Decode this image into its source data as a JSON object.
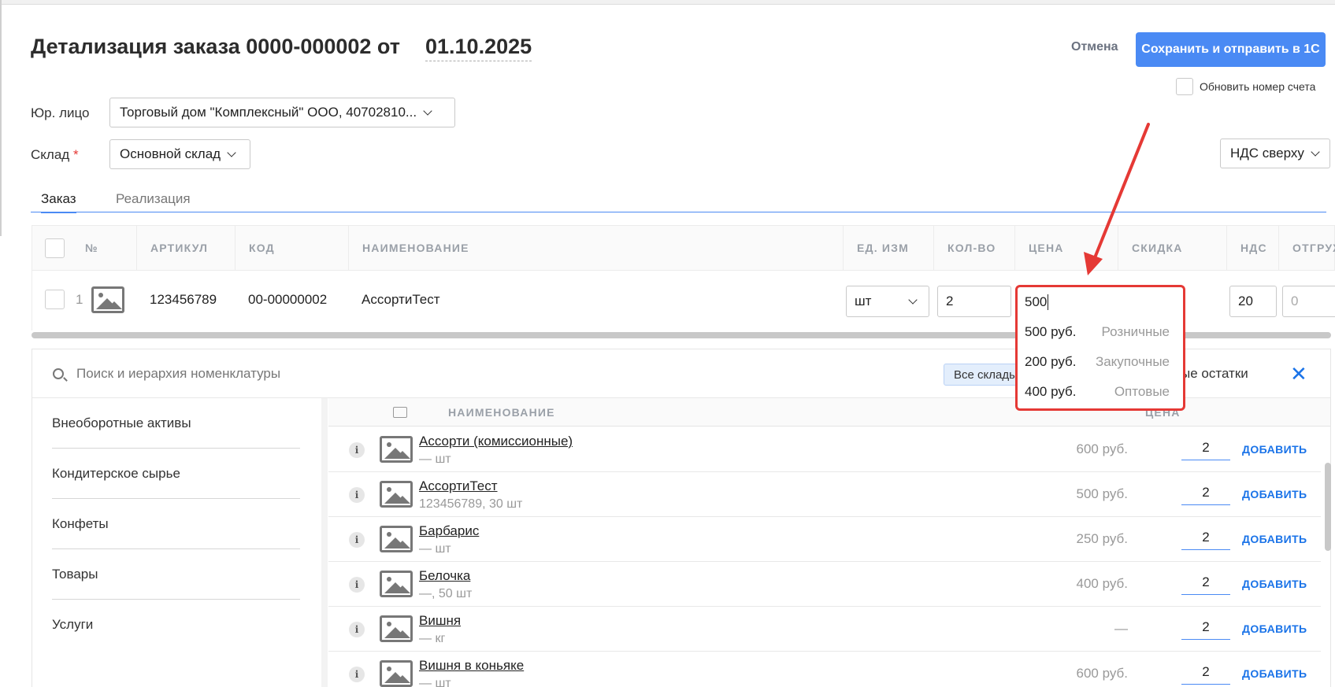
{
  "header": {
    "title": "Детализация заказа 0000-000002 от",
    "date": "01.10.2025",
    "cancel_label": "Отмена",
    "save_label": "Сохранить и отправить в 1С",
    "update_invoice_label": "Обновить номер счета"
  },
  "form": {
    "legal_label": "Юр. лицо",
    "legal_value": "Торговый дом \"Комплексный\" ООО, 40702810...",
    "warehouse_label": "Склад",
    "warehouse_required": "*",
    "warehouse_value": "Основной склад",
    "vat_mode": "НДС сверху"
  },
  "tabs": [
    "Заказ",
    "Реализация"
  ],
  "order_table": {
    "columns": [
      "№",
      "АРТИКУЛ",
      "КОД",
      "НАИМЕНОВАНИЕ",
      "ЕД. ИЗМ",
      "КОЛ-ВО",
      "ЦЕНА",
      "СКИДКА",
      "НДС",
      "ОТГРУЖЕНО"
    ],
    "rows": [
      {
        "num": "1",
        "article": "123456789",
        "code": "00-00000002",
        "name": "АссортиТест",
        "unit": "шт",
        "qty": "2",
        "price": "500",
        "vat": "20",
        "shipped": "0"
      }
    ]
  },
  "price_dropdown": [
    {
      "value": "500 руб.",
      "label": "Розничные"
    },
    {
      "value": "200 руб.",
      "label": "Закупочные"
    },
    {
      "value": "400 руб.",
      "label": "Оптовые"
    }
  ],
  "search": {
    "placeholder": "Поиск и иерархия номенклатуры",
    "all_warehouses": "Все склады",
    "stock_label": "ые остатки"
  },
  "categories": [
    "Внеоборотные активы",
    "Кондитерское сырье",
    "Конфеты",
    "Товары",
    "Услуги"
  ],
  "product_list": {
    "col_name": "НАИМЕНОВАНИЕ",
    "col_price": "ЦЕНА",
    "add_label": "ДОБАВИТЬ",
    "items": [
      {
        "name": "Ассорти (комиссионные)",
        "sub": "— шт",
        "price": "600 руб.",
        "qty": "2"
      },
      {
        "name": "АссортиТест",
        "sub": "123456789, 30 шт",
        "price": "500 руб.",
        "qty": "2"
      },
      {
        "name": "Барбарис",
        "sub": "— шт",
        "price": "250 руб.",
        "qty": "2"
      },
      {
        "name": "Белочка",
        "sub": "—, 50 шт",
        "price": "400 руб.",
        "qty": "2"
      },
      {
        "name": "Вишня",
        "sub": "— кг",
        "price": "—",
        "qty": "2"
      },
      {
        "name": "Вишня в коньяке",
        "sub": "— шт",
        "price": "600 руб.",
        "qty": "2"
      }
    ]
  },
  "colors": {
    "accent": "#4a8af4",
    "link": "#1a73e8",
    "annotation": "#e53935"
  }
}
